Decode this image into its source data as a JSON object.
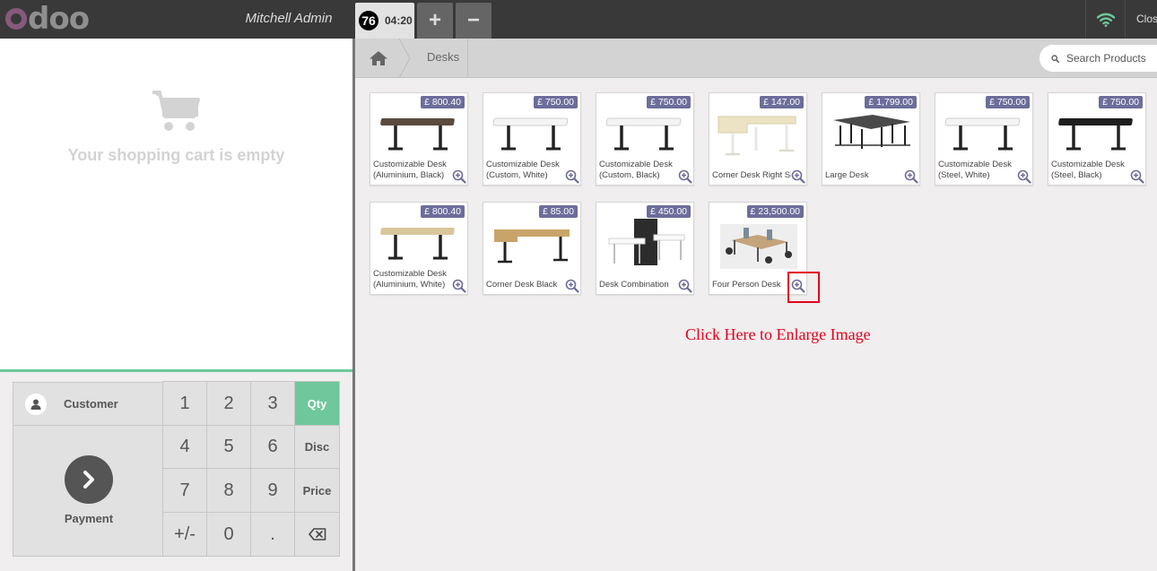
{
  "topbar": {
    "logo_text": "odoo",
    "username": "Mitchell Admin",
    "order": {
      "number": "76",
      "time": "04:20"
    },
    "add_label": "+",
    "remove_label": "−",
    "close_label": "Close",
    "wifi_color": "#6ec89b"
  },
  "cart": {
    "empty_text": "Your shopping cart is empty"
  },
  "numpad": {
    "customer_label": "Customer",
    "payment_label": "Payment",
    "keys": [
      "1",
      "2",
      "3",
      "Qty",
      "4",
      "5",
      "6",
      "Disc",
      "7",
      "8",
      "9",
      "Price",
      "+/-",
      "0",
      "."
    ],
    "active_mode": "Qty"
  },
  "breadcrumb": {
    "current": "Desks"
  },
  "search": {
    "placeholder": "Search Products"
  },
  "products": [
    {
      "price": "£ 800.40",
      "name": "Customizable Desk (Aluminium, Black)",
      "img": "desk-walnut"
    },
    {
      "price": "£ 750.00",
      "name": "Customizable Desk (Custom, White)",
      "img": "desk-white"
    },
    {
      "price": "£ 750.00",
      "name": "Customizable Desk (Custom, Black)",
      "img": "desk-white"
    },
    {
      "price": "£ 147.00",
      "name": "Corner Desk Right Sit",
      "img": "desk-corner-light"
    },
    {
      "price": "£ 1,799.00",
      "name": "Large Desk",
      "img": "desk-large"
    },
    {
      "price": "£ 750.00",
      "name": "Customizable Desk (Steel, White)",
      "img": "desk-white"
    },
    {
      "price": "£ 750.00",
      "name": "Customizable Desk (Steel, Black)",
      "img": "desk-black"
    },
    {
      "price": "£ 800.40",
      "name": "Customizable Desk (Aluminium, White)",
      "img": "desk-oak"
    },
    {
      "price": "£ 85.00",
      "name": "Corner Desk Black",
      "img": "desk-corner-oak"
    },
    {
      "price": "£ 450.00",
      "name": "Desk Combination",
      "img": "desk-combo"
    },
    {
      "price": "£ 23,500.00",
      "name": "Four Person Desk",
      "img": "desk-four"
    }
  ],
  "annotation": {
    "note": "Click Here to Enlarge Image",
    "color": "#e2001a"
  }
}
